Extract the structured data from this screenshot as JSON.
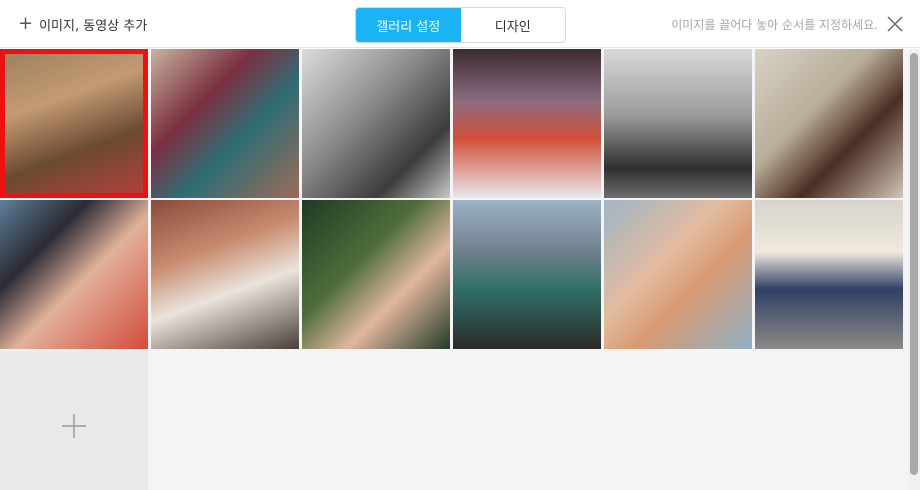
{
  "toolbar": {
    "add_label": "이미지, 동영상 추가",
    "tabs": [
      {
        "label": "갤러리 설정",
        "active": true
      },
      {
        "label": "디자인",
        "active": false
      }
    ],
    "hint": "이미지를 끌어다 놓아 순서를 지정하세요."
  },
  "colors": {
    "accent": "#1ab3f5",
    "selection": "#ee1111"
  },
  "gallery": {
    "columns": 6,
    "selected_index": 0,
    "items": [
      {
        "name": "photo-curly-hair-woman",
        "bg": "linear-gradient(160deg,#9a7f5e 0%,#c49a72 35%,#6a4a32 65%,#b9403b 100%)"
      },
      {
        "name": "photo-aztec-sweater",
        "bg": "linear-gradient(135deg,#c8b3a0 0%,#7a2f3f 35%,#2f6d74 60%,#9c6b58 100%)"
      },
      {
        "name": "photo-fashion-backstage",
        "bg": "linear-gradient(135deg,#dcdcdc 0%,#8e8e8e 40%,#3c3c3c 75%,#c8c8c8 100%)"
      },
      {
        "name": "photo-runway-show",
        "bg": "linear-gradient(180deg,#3a2b30 0%,#8b6c80 35%,#d04f38 60%,#e9e9ee 100%)"
      },
      {
        "name": "photo-bw-field-woman",
        "bg": "linear-gradient(180deg,#d9d9d9 0%,#9a9a9a 45%,#2e2e2e 80%,#6e6e6e 100%)"
      },
      {
        "name": "photo-brown-blouse-wall",
        "bg": "linear-gradient(135deg,#d8d2c6 0%,#b8ad99 40%,#4b2d22 65%,#cfc6b6 100%)"
      },
      {
        "name": "photo-wide-brim-hat",
        "bg": "linear-gradient(135deg,#5e7f9a 0%,#2b2b33 30%,#e1b19a 55%,#d24b3c 100%)"
      },
      {
        "name": "photo-brick-alley",
        "bg": "linear-gradient(160deg,#8a4a3a 0%,#c98c70 35%,#e9e4dc 60%,#4a3e3a 100%)"
      },
      {
        "name": "photo-floral-dress-garden",
        "bg": "linear-gradient(135deg,#1f3a24 0%,#4f6e3a 40%,#e2b69f 65%,#233a28 100%)"
      },
      {
        "name": "photo-city-street-woman",
        "bg": "linear-gradient(180deg,#9db3c8 0%,#6f7f8c 35%,#2f6f66 60%,#2a2a2a 100%)"
      },
      {
        "name": "photo-turtleneck-portrait",
        "bg": "linear-gradient(135deg,#9fb5c6 0%,#e3bca0 40%,#d89a72 60%,#8fb0c4 100%)"
      },
      {
        "name": "photo-stairs-sitting",
        "bg": "linear-gradient(180deg,#d7d4cc 0%,#efe9de 35%,#2f3f66 60%,#8c8a86 100%)"
      }
    ]
  }
}
